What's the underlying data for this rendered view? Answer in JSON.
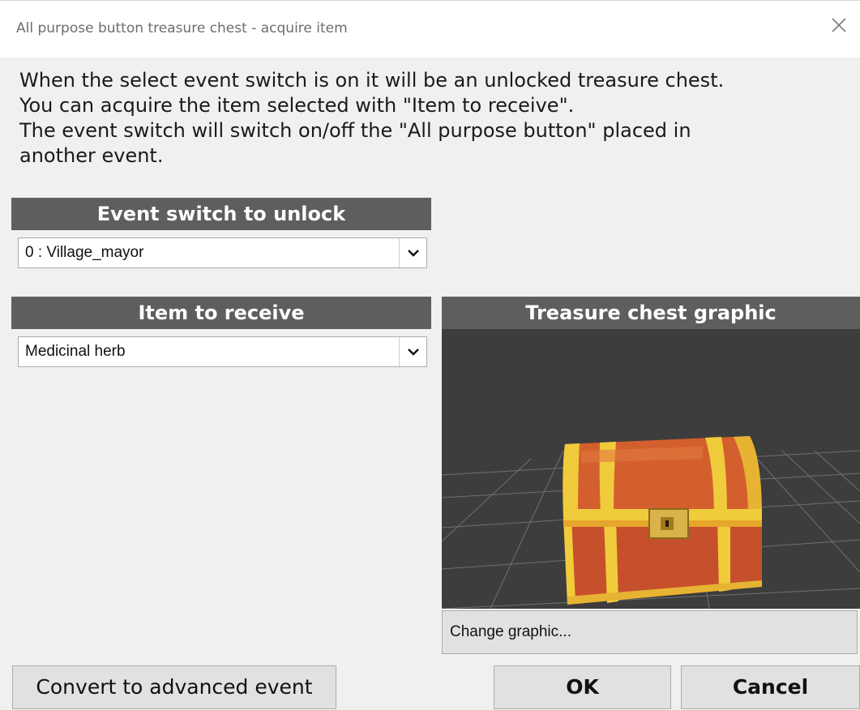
{
  "window": {
    "title": "All purpose button treasure chest - acquire item"
  },
  "description": {
    "lines": [
      "When the select event switch is on it will be an unlocked treasure chest.",
      "You can acquire the item selected with \"Item to receive\".",
      "The event switch will switch on/off the \"All purpose button\" placed in",
      "another event."
    ]
  },
  "event_switch": {
    "header": "Event switch to unlock",
    "selected": "0 : Village_mayor"
  },
  "item": {
    "header": "Item to receive",
    "selected": "Medicinal herb"
  },
  "graphic": {
    "header": "Treasure chest graphic",
    "change_label": "Change graphic..."
  },
  "buttons": {
    "convert_label": "Convert to advanced event",
    "ok_label": "OK",
    "cancel_label": "Cancel"
  },
  "icons": {
    "close": "close-icon",
    "dropdown": "chevron-down-icon",
    "preview": "treasure-chest-icon"
  },
  "colors": {
    "header_bg": "#5e5e5e",
    "preview_bg": "#3d3d3d",
    "chest_wood": "#c6502c",
    "chest_trim": "#f0cb3c"
  }
}
